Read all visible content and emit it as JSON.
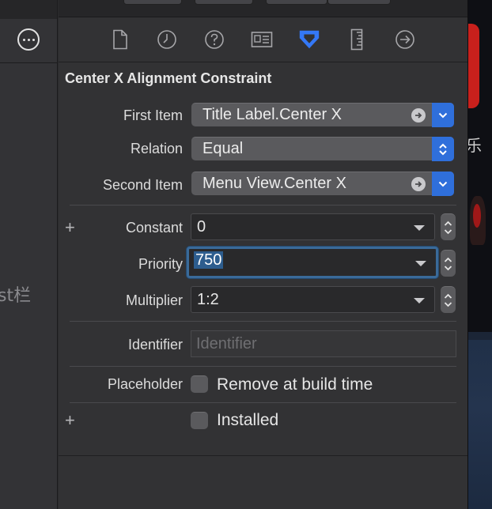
{
  "sidebar": {
    "cut_text": "st栏"
  },
  "inspector": {
    "tabs": [
      {
        "name": "file-inspector",
        "icon": "document-icon",
        "active": false
      },
      {
        "name": "history-inspector",
        "icon": "clock-icon",
        "active": false
      },
      {
        "name": "quick-help-inspector",
        "icon": "question-icon",
        "active": false
      },
      {
        "name": "identity-inspector",
        "icon": "id-card-icon",
        "active": false
      },
      {
        "name": "attributes-inspector",
        "icon": "attributes-arrow-icon",
        "active": true
      },
      {
        "name": "size-inspector",
        "icon": "ruler-icon",
        "active": false
      },
      {
        "name": "connections-inspector",
        "icon": "arrow-circle-icon",
        "active": false
      }
    ],
    "section_title": "Center X Alignment Constraint",
    "first_item": {
      "label": "First Item",
      "value": "Title Label.Center X"
    },
    "relation": {
      "label": "Relation",
      "value": "Equal"
    },
    "second_item": {
      "label": "Second Item",
      "value": "Menu View.Center X"
    },
    "constant": {
      "label": "Constant",
      "value": "0"
    },
    "priority": {
      "label": "Priority",
      "value": "750"
    },
    "multiplier": {
      "label": "Multiplier",
      "value": "1:2"
    },
    "identifier": {
      "label": "Identifier",
      "value": "",
      "placeholder": "Identifier"
    },
    "placeholder": {
      "label": "Placeholder",
      "checkbox_label": "Remove at build time",
      "checked": false
    },
    "installed": {
      "checkbox_label": "Installed",
      "checked": false
    },
    "plus_symbol": "+"
  },
  "background": {
    "cut_char": "乐"
  },
  "colors": {
    "accent": "#2f6fdb",
    "active_tab": "#3478f6",
    "panel": "#323234",
    "focus_ring": "#3a6a99"
  }
}
